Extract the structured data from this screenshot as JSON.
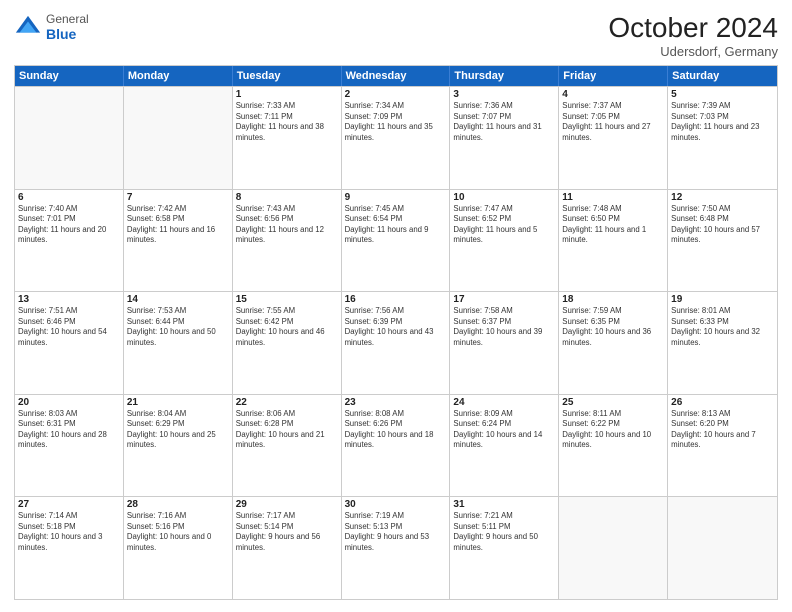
{
  "header": {
    "logo_general": "General",
    "logo_blue": "Blue",
    "month_title": "October 2024",
    "location": "Udersdorf, Germany"
  },
  "days_of_week": [
    "Sunday",
    "Monday",
    "Tuesday",
    "Wednesday",
    "Thursday",
    "Friday",
    "Saturday"
  ],
  "rows": [
    [
      {
        "day": "",
        "empty": true
      },
      {
        "day": "",
        "empty": true
      },
      {
        "day": "1",
        "sunrise": "Sunrise: 7:33 AM",
        "sunset": "Sunset: 7:11 PM",
        "daylight": "Daylight: 11 hours and 38 minutes."
      },
      {
        "day": "2",
        "sunrise": "Sunrise: 7:34 AM",
        "sunset": "Sunset: 7:09 PM",
        "daylight": "Daylight: 11 hours and 35 minutes."
      },
      {
        "day": "3",
        "sunrise": "Sunrise: 7:36 AM",
        "sunset": "Sunset: 7:07 PM",
        "daylight": "Daylight: 11 hours and 31 minutes."
      },
      {
        "day": "4",
        "sunrise": "Sunrise: 7:37 AM",
        "sunset": "Sunset: 7:05 PM",
        "daylight": "Daylight: 11 hours and 27 minutes."
      },
      {
        "day": "5",
        "sunrise": "Sunrise: 7:39 AM",
        "sunset": "Sunset: 7:03 PM",
        "daylight": "Daylight: 11 hours and 23 minutes."
      }
    ],
    [
      {
        "day": "6",
        "sunrise": "Sunrise: 7:40 AM",
        "sunset": "Sunset: 7:01 PM",
        "daylight": "Daylight: 11 hours and 20 minutes."
      },
      {
        "day": "7",
        "sunrise": "Sunrise: 7:42 AM",
        "sunset": "Sunset: 6:58 PM",
        "daylight": "Daylight: 11 hours and 16 minutes."
      },
      {
        "day": "8",
        "sunrise": "Sunrise: 7:43 AM",
        "sunset": "Sunset: 6:56 PM",
        "daylight": "Daylight: 11 hours and 12 minutes."
      },
      {
        "day": "9",
        "sunrise": "Sunrise: 7:45 AM",
        "sunset": "Sunset: 6:54 PM",
        "daylight": "Daylight: 11 hours and 9 minutes."
      },
      {
        "day": "10",
        "sunrise": "Sunrise: 7:47 AM",
        "sunset": "Sunset: 6:52 PM",
        "daylight": "Daylight: 11 hours and 5 minutes."
      },
      {
        "day": "11",
        "sunrise": "Sunrise: 7:48 AM",
        "sunset": "Sunset: 6:50 PM",
        "daylight": "Daylight: 11 hours and 1 minute."
      },
      {
        "day": "12",
        "sunrise": "Sunrise: 7:50 AM",
        "sunset": "Sunset: 6:48 PM",
        "daylight": "Daylight: 10 hours and 57 minutes."
      }
    ],
    [
      {
        "day": "13",
        "sunrise": "Sunrise: 7:51 AM",
        "sunset": "Sunset: 6:46 PM",
        "daylight": "Daylight: 10 hours and 54 minutes."
      },
      {
        "day": "14",
        "sunrise": "Sunrise: 7:53 AM",
        "sunset": "Sunset: 6:44 PM",
        "daylight": "Daylight: 10 hours and 50 minutes."
      },
      {
        "day": "15",
        "sunrise": "Sunrise: 7:55 AM",
        "sunset": "Sunset: 6:42 PM",
        "daylight": "Daylight: 10 hours and 46 minutes."
      },
      {
        "day": "16",
        "sunrise": "Sunrise: 7:56 AM",
        "sunset": "Sunset: 6:39 PM",
        "daylight": "Daylight: 10 hours and 43 minutes."
      },
      {
        "day": "17",
        "sunrise": "Sunrise: 7:58 AM",
        "sunset": "Sunset: 6:37 PM",
        "daylight": "Daylight: 10 hours and 39 minutes."
      },
      {
        "day": "18",
        "sunrise": "Sunrise: 7:59 AM",
        "sunset": "Sunset: 6:35 PM",
        "daylight": "Daylight: 10 hours and 36 minutes."
      },
      {
        "day": "19",
        "sunrise": "Sunrise: 8:01 AM",
        "sunset": "Sunset: 6:33 PM",
        "daylight": "Daylight: 10 hours and 32 minutes."
      }
    ],
    [
      {
        "day": "20",
        "sunrise": "Sunrise: 8:03 AM",
        "sunset": "Sunset: 6:31 PM",
        "daylight": "Daylight: 10 hours and 28 minutes."
      },
      {
        "day": "21",
        "sunrise": "Sunrise: 8:04 AM",
        "sunset": "Sunset: 6:29 PM",
        "daylight": "Daylight: 10 hours and 25 minutes."
      },
      {
        "day": "22",
        "sunrise": "Sunrise: 8:06 AM",
        "sunset": "Sunset: 6:28 PM",
        "daylight": "Daylight: 10 hours and 21 minutes."
      },
      {
        "day": "23",
        "sunrise": "Sunrise: 8:08 AM",
        "sunset": "Sunset: 6:26 PM",
        "daylight": "Daylight: 10 hours and 18 minutes."
      },
      {
        "day": "24",
        "sunrise": "Sunrise: 8:09 AM",
        "sunset": "Sunset: 6:24 PM",
        "daylight": "Daylight: 10 hours and 14 minutes."
      },
      {
        "day": "25",
        "sunrise": "Sunrise: 8:11 AM",
        "sunset": "Sunset: 6:22 PM",
        "daylight": "Daylight: 10 hours and 10 minutes."
      },
      {
        "day": "26",
        "sunrise": "Sunrise: 8:13 AM",
        "sunset": "Sunset: 6:20 PM",
        "daylight": "Daylight: 10 hours and 7 minutes."
      }
    ],
    [
      {
        "day": "27",
        "sunrise": "Sunrise: 7:14 AM",
        "sunset": "Sunset: 5:18 PM",
        "daylight": "Daylight: 10 hours and 3 minutes."
      },
      {
        "day": "28",
        "sunrise": "Sunrise: 7:16 AM",
        "sunset": "Sunset: 5:16 PM",
        "daylight": "Daylight: 10 hours and 0 minutes."
      },
      {
        "day": "29",
        "sunrise": "Sunrise: 7:17 AM",
        "sunset": "Sunset: 5:14 PM",
        "daylight": "Daylight: 9 hours and 56 minutes."
      },
      {
        "day": "30",
        "sunrise": "Sunrise: 7:19 AM",
        "sunset": "Sunset: 5:13 PM",
        "daylight": "Daylight: 9 hours and 53 minutes."
      },
      {
        "day": "31",
        "sunrise": "Sunrise: 7:21 AM",
        "sunset": "Sunset: 5:11 PM",
        "daylight": "Daylight: 9 hours and 50 minutes."
      },
      {
        "day": "",
        "empty": true
      },
      {
        "day": "",
        "empty": true
      }
    ]
  ]
}
